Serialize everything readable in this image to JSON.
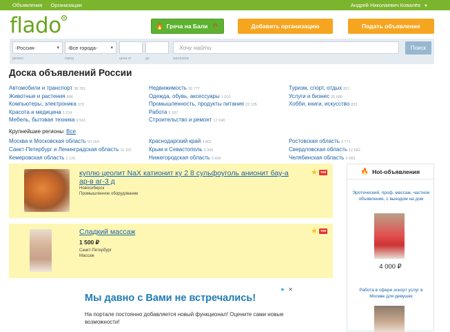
{
  "topbar": {
    "links": [
      "Объявления",
      "Организации"
    ],
    "user": "Андрей Николаевич Ковалёв"
  },
  "logo": "flado",
  "header": {
    "greca_label": "Греча на Бали",
    "add_org_label": "Добавить организацию",
    "post_ad_label": "Подать объявление"
  },
  "search": {
    "region_value": "-Россия-",
    "city_value": "-Все города-",
    "query_placeholder": "Хочу найти",
    "button_label": "Поиск",
    "captions": {
      "region": "регион",
      "city": "город",
      "price_from": "цена от",
      "price_to": "до",
      "query": "заголовок"
    }
  },
  "page_title": "Доска объявлений России",
  "categories": [
    [
      {
        "label": "Автомобили и транспорт",
        "count": "38 781"
      },
      {
        "label": "Животные и растения",
        "count": "898"
      },
      {
        "label": "Компьютеры, электроника",
        "count": "973"
      },
      {
        "label": "Красота и медицина",
        "count": "5 214"
      },
      {
        "label": "Мебель, бытовая техника",
        "count": "4 561"
      }
    ],
    [
      {
        "label": "Недвижимость",
        "count": "30 777"
      },
      {
        "label": "Одежда, обувь, аксессуары",
        "count": "1 010"
      },
      {
        "label": "Промышленность, продукты питания",
        "count": "23 135"
      },
      {
        "label": "Работа",
        "count": "5 187"
      },
      {
        "label": "Строительство и ремонт",
        "count": "17 048"
      }
    ],
    [
      {
        "label": "Туризм, спорт, отдых",
        "count": "821"
      },
      {
        "label": "Услуги и бизнес",
        "count": "26 680"
      },
      {
        "label": "Хобби, книги, искусство",
        "count": "833"
      }
    ]
  ],
  "regions": {
    "heading": "Крупнейшие регионы",
    "all_label": "Все",
    "columns": [
      [
        {
          "label": "Москва и Московская область",
          "count": "53 164"
        },
        {
          "label": "Санкт-Петербург и Ленинградская область",
          "count": "11 107"
        },
        {
          "label": "Кемеровская область",
          "count": "2 126"
        }
      ],
      [
        {
          "label": "Краснодарский край",
          "count": "4 801"
        },
        {
          "label": "Крым и Севастополь",
          "count": "3 395"
        },
        {
          "label": "Нижегородская область",
          "count": "3 490"
        }
      ],
      [
        {
          "label": "Ростовская область",
          "count": "3 771"
        },
        {
          "label": "Свердловская область",
          "count": "12 582"
        },
        {
          "label": "Челябинская область",
          "count": "3 083"
        }
      ]
    ]
  },
  "ads": [
    {
      "title": "куплю цеолит NaX катионит ку 2 8 сульфоуголь анионит бау-а ар-в аг-3 д",
      "city": "Новосибирск",
      "category": "Промышленное оборудование",
      "badge": "топ"
    },
    {
      "title": "Сладкий массаж",
      "price": "1 500 ₽",
      "city": "Санкт-Петербург",
      "category": "Массаж",
      "badge": "топ"
    }
  ],
  "hot": {
    "heading": "Hot-объявления",
    "items": [
      {
        "title": "Эротический, проф. массаж, частное объявление, с выездом на дом",
        "price": "4 000 ₽"
      },
      {
        "title": "Работа в сфере эскорт услуг в Москве для девушек"
      }
    ]
  },
  "banner": {
    "title": "Мы давно с Вами не встречались!",
    "text": "На портале постоянно добавляется новый функционал! Оцените сами новые возможности!"
  }
}
